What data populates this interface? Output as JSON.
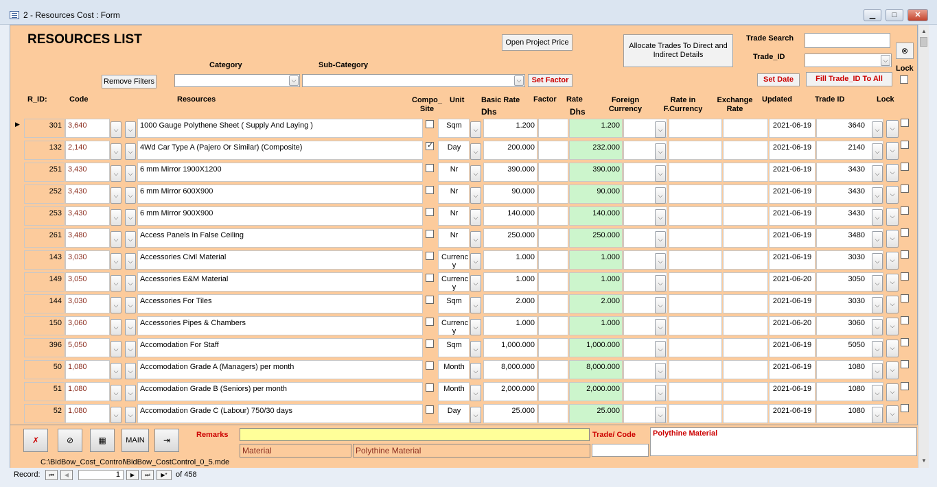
{
  "window": {
    "title": "2 - Resources Cost : Form",
    "min": "▁",
    "max": "□",
    "close": "✕"
  },
  "header": {
    "title": "RESOURCES LIST",
    "open_project_price": "Open Project Price",
    "allocate_trades": "Allocate Trades To Direct and Indirect Details",
    "trade_search_label": "Trade Search",
    "trade_search_value": "",
    "trade_id_label": "Trade_ID",
    "lock_label": "Lock",
    "category_label": "Category",
    "subcategory_label": "Sub-Category",
    "remove_filters": "Remove Filters",
    "set_factor": "Set Factor",
    "set_date": "Set Date",
    "fill_trade": "Fill Trade_ID To All"
  },
  "columns": {
    "rid": "R_ID:",
    "code": "Code",
    "resources": "Resources",
    "composite": "Compo_ Site",
    "unit": "Unit",
    "basic_rate": "Basic Rate",
    "dhs": "Dhs",
    "factor": "Factor",
    "rate": "Rate",
    "rate_dhs": "Dhs",
    "foreign": "Foreign Currency",
    "rate_fc": "Rate in F.Currency",
    "exchange": "Exchange Rate",
    "updated": "Updated",
    "trade_id": "Trade ID",
    "lock": "Lock"
  },
  "rows": [
    {
      "rid": "301",
      "code": "3,640",
      "resource": "1000 Gauge Polythene Sheet ( Supply And Laying )",
      "composite": false,
      "unit": "Sqm",
      "basic": "1.200",
      "rate": "1.200",
      "updated": "2021-06-19",
      "trade_id": "3640"
    },
    {
      "rid": "132",
      "code": "2,140",
      "resource": "4Wd Car Type A (Pajero Or Similar) (Composite)",
      "composite": true,
      "unit": "Day",
      "basic": "200.000",
      "rate": "232.000",
      "updated": "2021-06-19",
      "trade_id": "2140"
    },
    {
      "rid": "251",
      "code": "3,430",
      "resource": "6 mm Mirror  1900X1200",
      "composite": false,
      "unit": "Nr",
      "basic": "390.000",
      "rate": "390.000",
      "updated": "2021-06-19",
      "trade_id": "3430"
    },
    {
      "rid": "252",
      "code": "3,430",
      "resource": "6 mm Mirror 600X900",
      "composite": false,
      "unit": "Nr",
      "basic": "90.000",
      "rate": "90.000",
      "updated": "2021-06-19",
      "trade_id": "3430"
    },
    {
      "rid": "253",
      "code": "3,430",
      "resource": "6 mm Mirror 900X900",
      "composite": false,
      "unit": "Nr",
      "basic": "140.000",
      "rate": "140.000",
      "updated": "2021-06-19",
      "trade_id": "3430"
    },
    {
      "rid": "261",
      "code": "3,480",
      "resource": "Access Panels In False Ceiling",
      "composite": false,
      "unit": "Nr",
      "basic": "250.000",
      "rate": "250.000",
      "updated": "2021-06-19",
      "trade_id": "3480"
    },
    {
      "rid": "143",
      "code": "3,030",
      "resource": "Accessories Civil Material",
      "composite": false,
      "unit": "Currenc y",
      "basic": "1.000",
      "rate": "1.000",
      "updated": "2021-06-19",
      "trade_id": "3030"
    },
    {
      "rid": "149",
      "code": "3,050",
      "resource": "Accessories E&M Material",
      "composite": false,
      "unit": "Currenc y",
      "basic": "1.000",
      "rate": "1.000",
      "updated": "2021-06-20",
      "trade_id": "3050"
    },
    {
      "rid": "144",
      "code": "3,030",
      "resource": "Accessories For Tiles",
      "composite": false,
      "unit": "Sqm",
      "basic": "2.000",
      "rate": "2.000",
      "updated": "2021-06-19",
      "trade_id": "3030"
    },
    {
      "rid": "150",
      "code": "3,060",
      "resource": "Accessories Pipes & Chambers",
      "composite": false,
      "unit": "Currenc y",
      "basic": "1.000",
      "rate": "1.000",
      "updated": "2021-06-20",
      "trade_id": "3060"
    },
    {
      "rid": "396",
      "code": "5,050",
      "resource": "Accomodation For Staff",
      "composite": false,
      "unit": "Sqm",
      "basic": "1,000.000",
      "rate": "1,000.000",
      "updated": "2021-06-19",
      "trade_id": "5050"
    },
    {
      "rid": "50",
      "code": "1,080",
      "resource": "Accomodation Grade A (Managers) per month",
      "composite": false,
      "unit": "Month",
      "basic": "8,000.000",
      "rate": "8,000.000",
      "updated": "2021-06-19",
      "trade_id": "1080"
    },
    {
      "rid": "51",
      "code": "1,080",
      "resource": "Accomodation Grade B (Seniors) per month",
      "composite": false,
      "unit": "Month",
      "basic": "2,000.000",
      "rate": "2,000.000",
      "updated": "2021-06-19",
      "trade_id": "1080"
    },
    {
      "rid": "52",
      "code": "1,080",
      "resource": "Accomodation Grade C (Labour) 750/30 days",
      "composite": false,
      "unit": "Day",
      "basic": "25.000",
      "rate": "25.000",
      "updated": "2021-06-19",
      "trade_id": "1080"
    }
  ],
  "footer": {
    "main_label": "MAIN",
    "remarks_label": "Remarks",
    "remarks_value": "",
    "trade_code_label": "Trade/ Code",
    "category_value": "Material",
    "subcategory_value": "Polythine Material",
    "memo_value": "Polythine Material",
    "path": "C:\\BidBow_Cost_Control\\BidBow_CostControl_0_5.mde"
  },
  "record_nav": {
    "label": "Record:",
    "current": "1",
    "of_label": "of  458"
  },
  "icons": {
    "first": "⏮",
    "prev": "◀",
    "next": "▶",
    "last": "⏭",
    "new": "▶*"
  }
}
